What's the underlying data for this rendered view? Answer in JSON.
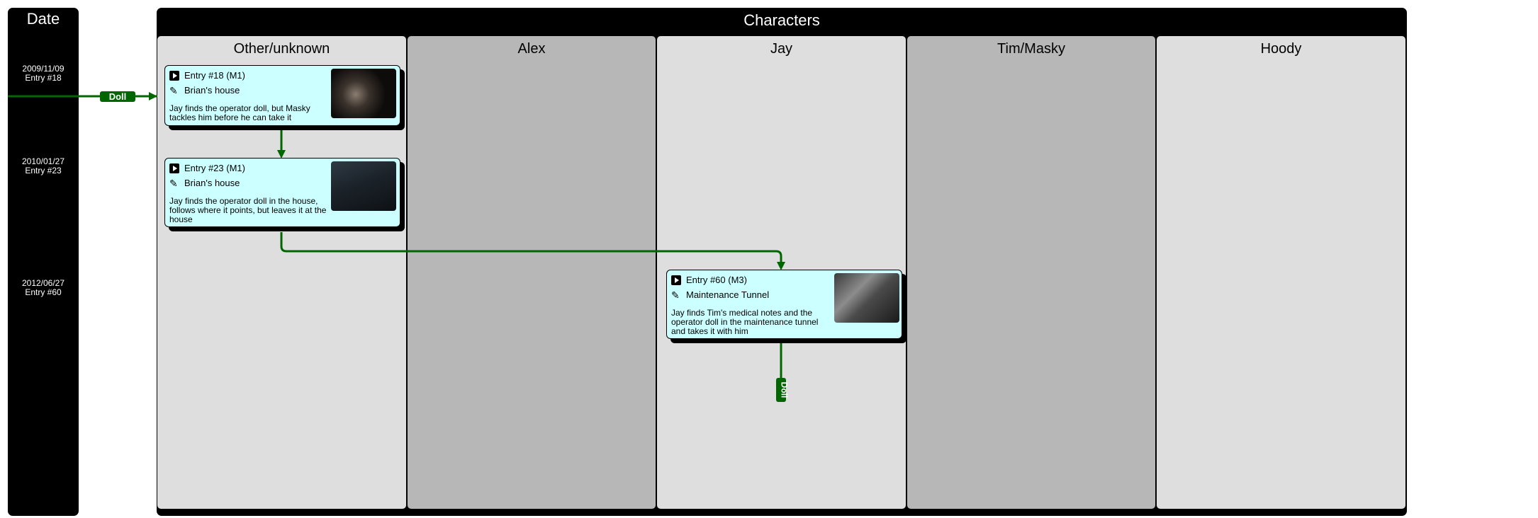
{
  "date_column": {
    "title": "Date",
    "dates": [
      {
        "date": "2009/11/09",
        "entry": "Entry #18"
      },
      {
        "date": "2010/01/27",
        "entry": "Entry #23"
      },
      {
        "date": "2012/06/27",
        "entry": "Entry #60"
      }
    ]
  },
  "characters": {
    "title": "Characters",
    "lanes": [
      {
        "name": "Other/unknown"
      },
      {
        "name": "Alex"
      },
      {
        "name": "Jay"
      },
      {
        "name": "Tim/Masky"
      },
      {
        "name": "Hoody"
      }
    ]
  },
  "entries": [
    {
      "title": "Entry #18 (M1)",
      "location": "Brian's house",
      "desc_lines": [
        "Jay finds the operator doll, but Masky",
        "tackles him before he can take it"
      ]
    },
    {
      "title": "Entry #23 (M1)",
      "location": "Brian's house",
      "desc_lines": [
        "Jay finds the operator doll in the house,",
        "follows where it points, but leaves it at the",
        "house"
      ]
    },
    {
      "title": "Entry #60 (M3)",
      "location": "Maintenance Tunnel",
      "desc_lines": [
        "Jay finds Tim's medical notes and the",
        "operator doll in the maintenance tunnel",
        "and takes it with him"
      ]
    }
  ],
  "item_tags": {
    "incoming": "Doll",
    "outgoing": "Doll"
  },
  "colors": {
    "connector": "#006600",
    "card": "#ccffff",
    "lane_light": "#dedede",
    "lane_dark": "#b7b7b7"
  }
}
